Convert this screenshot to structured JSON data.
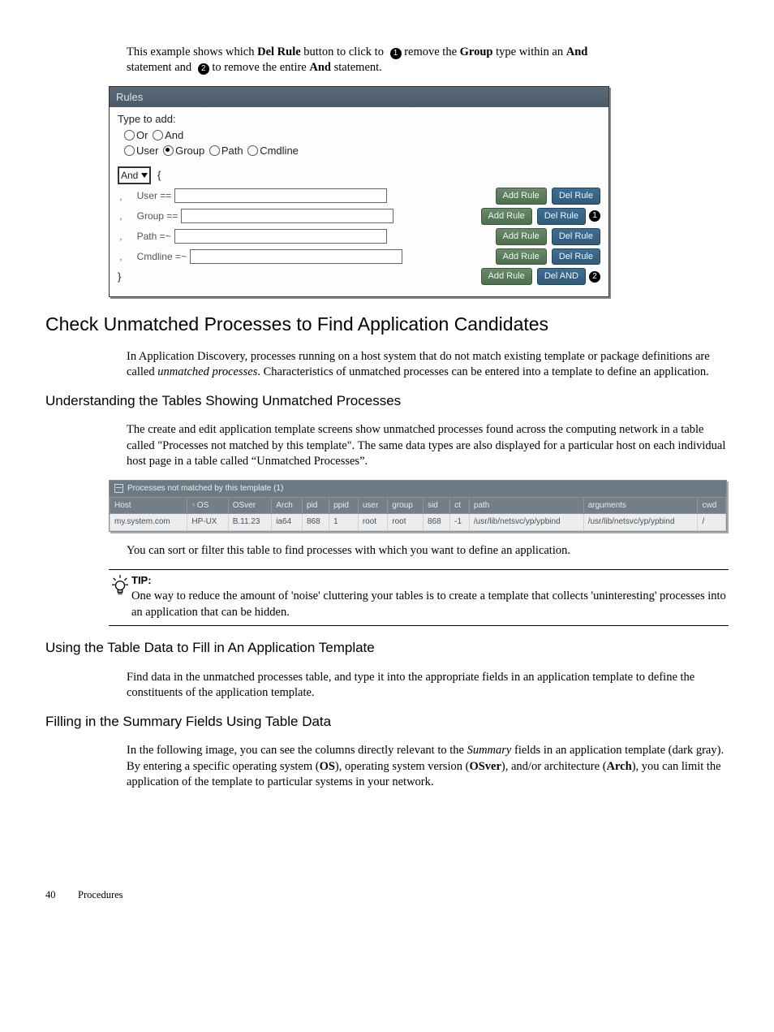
{
  "intro": {
    "line1_pre": "This example shows which ",
    "line1_bold1": "Del Rule",
    "line1_mid1": " button to click to ",
    "callout1": "1",
    "line1_mid2": " remove the ",
    "line1_bold2": "Group",
    "line1_mid3": " type within an ",
    "line1_bold3": "And",
    "line2_pre": "statement and ",
    "callout2": "2",
    "line2_mid": " to remove the entire ",
    "line2_bold": "And",
    "line2_end": "  statement."
  },
  "rules": {
    "title": "Rules",
    "type_to_add": "Type to add:",
    "r_or": "Or",
    "r_and": "And",
    "r_user": "User",
    "r_group": "Group",
    "r_path": "Path",
    "r_cmd": "Cmdline",
    "and_label": "And",
    "brace_open": "{",
    "brace_close": "}",
    "lines": [
      {
        "label": "User ==",
        "add": "Add Rule",
        "del": "Del Rule"
      },
      {
        "label": "Group ==",
        "add": "Add Rule",
        "del": "Del Rule"
      },
      {
        "label": "Path =~",
        "add": "Add Rule",
        "del": "Del Rule"
      },
      {
        "label": "Cmdline =~",
        "add": "Add Rule",
        "del": "Del Rule"
      }
    ],
    "final_add": "Add Rule",
    "final_del": "Del AND"
  },
  "h_check": "Check Unmatched Processes to Find Application Candidates",
  "p_check": "In Application Discovery, processes running on a host system that do not match existing template or package definitions are called ",
  "p_check_it": "unmatched processes",
  "p_check_end": ". Characteristics of unmatched processes can be entered into a template to define an application.",
  "h_understand": "Understanding the Tables Showing Unmatched Processes",
  "p_understand": "The create and edit application template screens show unmatched processes found across the computing network in a table called \"Processes not matched by this template\". The same data types are also displayed for a particular host on each individual host page in a table called “Unmatched Processes”.",
  "proc": {
    "title": "Processes not matched by this template (1)",
    "cols": [
      "Host",
      "OS",
      "OSver",
      "Arch",
      "pid",
      "ppid",
      "user",
      "group",
      "sid",
      "ct",
      "path",
      "arguments",
      "cwd"
    ],
    "row": [
      "my.system.com",
      "HP-UX",
      "B.11.23",
      "ia64",
      "868",
      "1",
      "root",
      "root",
      "868",
      "-1",
      "/usr/lib/netsvc/yp/ypbind",
      "/usr/lib/netsvc/yp/ypbind",
      "/"
    ]
  },
  "p_sort": "You can sort or filter this table to find processes with which you want to define an application.",
  "tip": {
    "label": "TIP:",
    "text": "One way to reduce the amount of 'noise' cluttering your tables is to create a template that collects 'uninteresting' processes into an application that can be hidden."
  },
  "h_using": "Using the Table Data to Fill in An Application Template",
  "p_using": "Find data in the unmatched processes table, and type it into the appropriate fields in an application template to define the constituents of the application template.",
  "h_fill": "Filling in the Summary Fields Using Table Data",
  "p_fill_1": "In the following image, you can see the columns directly relevant to the ",
  "p_fill_it": "Summary",
  "p_fill_2": " fields in an application template (dark gray). By entering a specific operating system (",
  "p_fill_b1": "OS",
  "p_fill_3": "), operating system version (",
  "p_fill_b2": "OSver",
  "p_fill_4": "), and/or architecture (",
  "p_fill_b3": "Arch",
  "p_fill_5": "), you can limit the application of the template to particular systems in your network.",
  "footer": {
    "page": "40",
    "section": "Procedures"
  }
}
